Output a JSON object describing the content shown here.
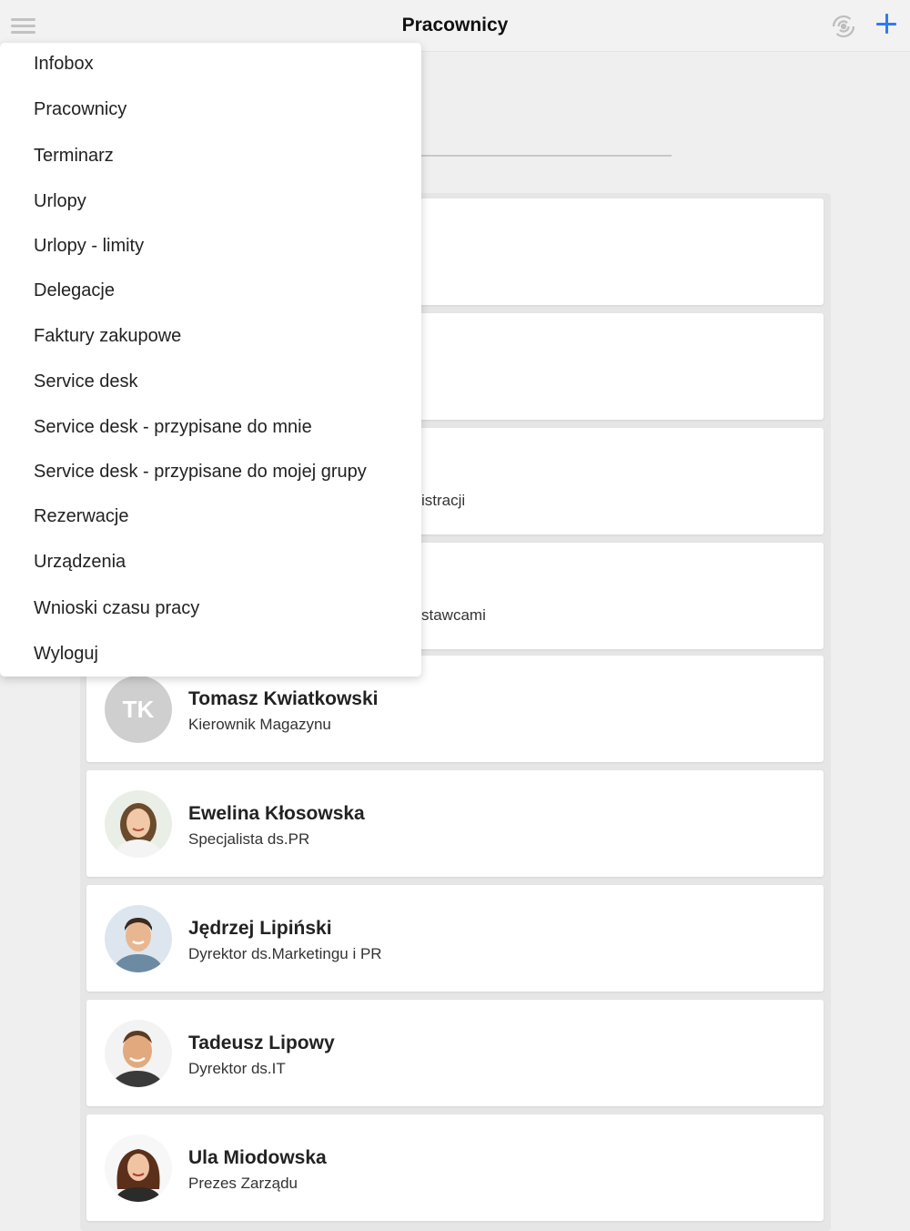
{
  "header": {
    "title": "Pracownicy",
    "menu_icon": "hamburger-icon",
    "sync_icon": "sync-icon",
    "add_icon": "plus-icon",
    "accent_color": "#2d7bf4"
  },
  "menu": {
    "items": [
      {
        "label": "Infobox"
      },
      {
        "label": "Pracownicy"
      },
      {
        "label": "Terminarz"
      },
      {
        "label": "Urlopy"
      },
      {
        "label": "Urlopy - limity"
      },
      {
        "label": "Delegacje"
      },
      {
        "label": "Faktury zakupowe"
      },
      {
        "label": "Service desk"
      },
      {
        "label": "Service desk - przypisane do mnie"
      },
      {
        "label": "Service desk - przypisane do mojej grupy"
      },
      {
        "label": "Rezerwacje"
      },
      {
        "label": "Urządzenia"
      },
      {
        "label": "Wnioski czasu pracy"
      },
      {
        "label": "Wyloguj"
      }
    ]
  },
  "employees": {
    "partial_roles": [
      "istracji",
      "stawcami"
    ],
    "items": [
      {
        "name": "Tomasz Kwiatkowski",
        "role": "Kierownik Magazynu",
        "initials": "TK"
      },
      {
        "name": "Ewelina Kłosowska",
        "role": "Specjalista ds.PR"
      },
      {
        "name": "Jędrzej Lipiński",
        "role": "Dyrektor ds.Marketingu i PR"
      },
      {
        "name": "Tadeusz Lipowy",
        "role": "Dyrektor ds.IT"
      },
      {
        "name": "Ula Miodowska",
        "role": "Prezes Zarządu"
      }
    ]
  }
}
